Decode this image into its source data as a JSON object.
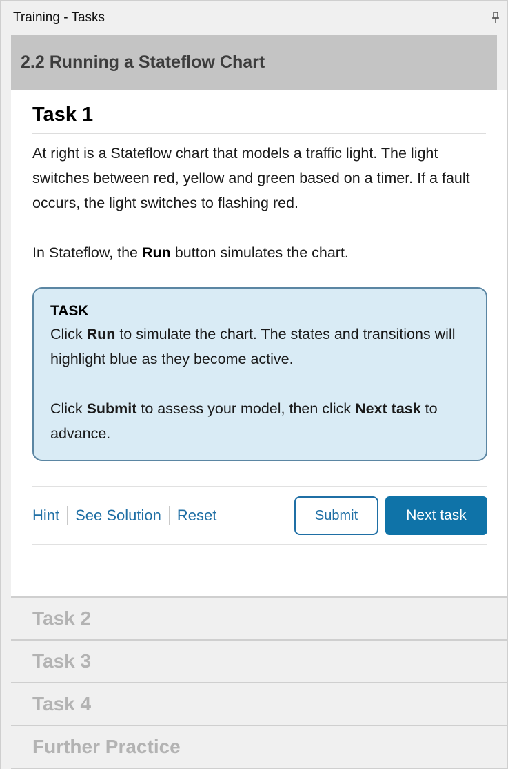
{
  "window": {
    "title": "Training - Tasks",
    "pin_icon": "pin-icon"
  },
  "section": {
    "title": "2.2 Running a Stateflow Chart"
  },
  "task": {
    "title": "Task 1",
    "paragraph1": "At right is a Stateflow chart that models a traffic light. The light switches between red, yellow and green based on a timer. If a fault occurs, the light switches to flashing red.",
    "paragraph2_prefix": "In Stateflow, the ",
    "paragraph2_bold": "Run",
    "paragraph2_suffix": " button simulates the chart.",
    "box": {
      "heading": "TASK",
      "line1_prefix": "Click ",
      "line1_bold": "Run",
      "line1_suffix": " to simulate the chart. The states and transitions will highlight blue as they become active.",
      "line2_prefix": "Click ",
      "line2_bold1": "Submit",
      "line2_mid": " to assess your model, then click ",
      "line2_bold2": "Next task",
      "line2_suffix": " to advance."
    },
    "links": {
      "hint": "Hint",
      "see_solution": "See Solution",
      "reset": "Reset"
    },
    "buttons": {
      "submit": "Submit",
      "next": "Next task"
    }
  },
  "collapsed_tasks": [
    "Task 2",
    "Task 3",
    "Task 4",
    "Further Practice"
  ],
  "colors": {
    "link": "#1f6fa5",
    "next_button": "#0f73a8",
    "task_box_bg": "#d9ebf5",
    "task_box_border": "#5b86a3"
  }
}
